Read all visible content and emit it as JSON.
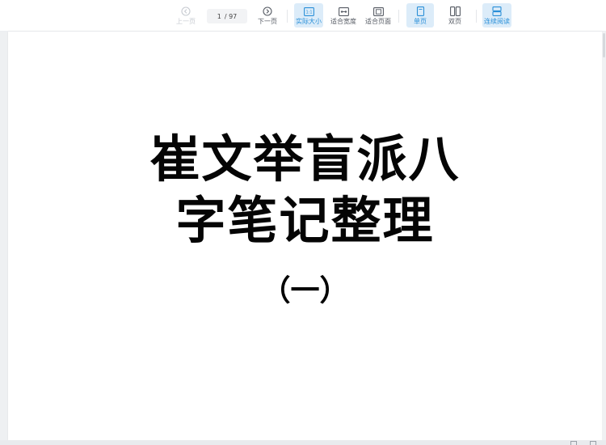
{
  "toolbar": {
    "prev_label": "上一页",
    "next_label": "下一页",
    "page_current": "1",
    "page_total": "/ 97",
    "actual_size_label": "实际大小",
    "fit_width_label": "适合宽度",
    "fit_page_label": "适合页面",
    "single_page_label": "单页",
    "double_page_label": "双页",
    "continuous_label": "连续阅读"
  },
  "document": {
    "title_line1": "崔文举盲派八",
    "title_line2": "字笔记整理",
    "subtitle": "（一）"
  },
  "colors": {
    "accent": "#2a8fd8",
    "active_bg": "#dcecf9"
  }
}
